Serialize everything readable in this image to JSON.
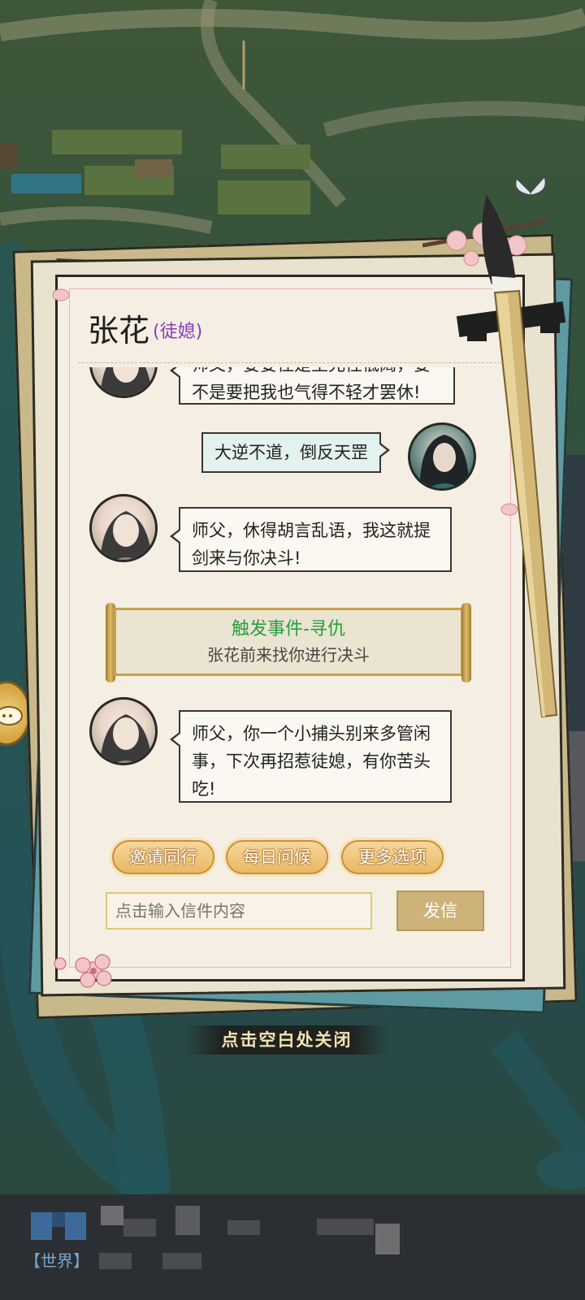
{
  "dialog": {
    "name": "张花",
    "relation": "(徒媳)"
  },
  "messages": [
    {
      "sender": "disciple",
      "text": "师父，要要住是至允性低阔，要不是要把我也气得不轻才罢休!"
    },
    {
      "sender": "master",
      "text": "大逆不道，倒反天罡"
    },
    {
      "sender": "disciple",
      "text": "师父，休得胡言乱语，我这就提剑来与你决斗!"
    },
    {
      "sender": "disciple",
      "text": "师父，你一个小捕头别来多管闲事，下次再招惹徒媳，有你苦头吃!"
    }
  ],
  "event": {
    "title": "触发事件-寻仇",
    "description": "张花前来找你进行决斗"
  },
  "actions": {
    "invite": "邀请同行",
    "greet": "每日问候",
    "more": "更多选项"
  },
  "input": {
    "placeholder": "点击输入信件内容"
  },
  "send_label": "发信",
  "close_hint": "点击空白处关闭",
  "chat_channel": "【世界】",
  "colors": {
    "relation": "#8a3dbb",
    "event_title": "#23a03c",
    "action_button": "#e9b865"
  }
}
